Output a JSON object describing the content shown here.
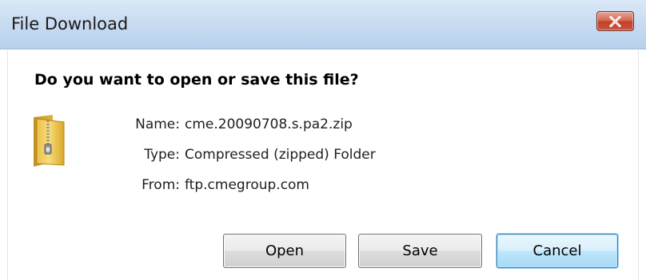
{
  "window": {
    "title": "File Download"
  },
  "dialog": {
    "question": "Do you want to open or save this file?",
    "file": {
      "icon": "zip-folder-icon",
      "name_label": "Name:",
      "name_value": "cme.20090708.s.pa2.zip",
      "type_label": "Type:",
      "type_value": "Compressed (zipped) Folder",
      "from_label": "From:",
      "from_value": "ftp.cmegroup.com"
    },
    "buttons": {
      "open": "Open",
      "save": "Save",
      "cancel": "Cancel"
    }
  },
  "colors": {
    "titlebar": "#c9dcf1",
    "close_button": "#c9553f",
    "default_button_border": "#3c7fb1"
  }
}
